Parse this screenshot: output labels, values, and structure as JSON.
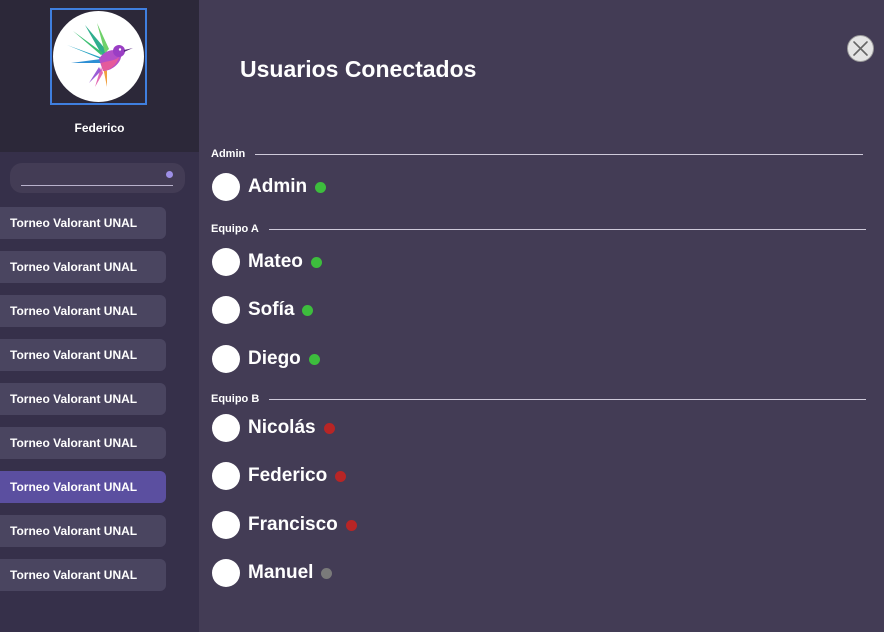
{
  "profile": {
    "name": "Federico"
  },
  "search": {
    "value": "",
    "placeholder": ""
  },
  "channels": [
    {
      "label": "Torneo Valorant UNAL",
      "active": false
    },
    {
      "label": "Torneo Valorant UNAL",
      "active": false
    },
    {
      "label": "Torneo Valorant UNAL",
      "active": false
    },
    {
      "label": "Torneo Valorant UNAL",
      "active": false
    },
    {
      "label": "Torneo Valorant UNAL",
      "active": false
    },
    {
      "label": "Torneo Valorant UNAL",
      "active": false
    },
    {
      "label": "Torneo Valorant UNAL",
      "active": true
    },
    {
      "label": "Torneo Valorant UNAL",
      "active": false
    },
    {
      "label": "Torneo Valorant UNAL",
      "active": false
    }
  ],
  "main": {
    "title": "Usuarios Conectados",
    "groups": [
      {
        "label": "Admin",
        "users": [
          {
            "name": "Admin",
            "status": "online"
          }
        ]
      },
      {
        "label": "Equipo A",
        "users": [
          {
            "name": "Mateo",
            "status": "online"
          },
          {
            "name": "Sofía",
            "status": "online"
          },
          {
            "name": "Diego",
            "status": "online"
          }
        ]
      },
      {
        "label": "Equipo B",
        "users": [
          {
            "name": "Nicolás",
            "status": "busy"
          },
          {
            "name": "Federico",
            "status": "busy"
          },
          {
            "name": "Francisco",
            "status": "busy"
          },
          {
            "name": "Manuel",
            "status": "offline"
          }
        ]
      }
    ]
  },
  "colors": {
    "online": "#3dbd3d",
    "busy": "#b82525",
    "offline": "#7a7a7a",
    "accent": "#5b4fa0",
    "avatar_border": "#3f7fe0"
  },
  "icons": {
    "avatar": "hummingbird-logo",
    "close": "close-icon"
  }
}
